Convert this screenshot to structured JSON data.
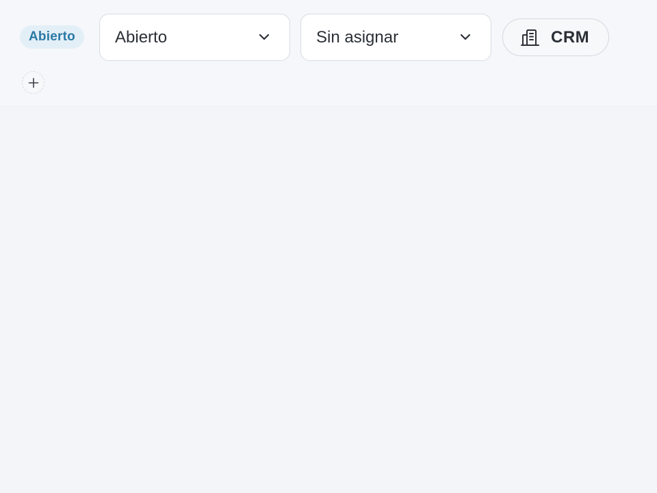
{
  "header": {
    "status_badge": "Abierto",
    "status_select": {
      "value": "Abierto",
      "icon": "chevron-down-icon"
    },
    "assignee_select": {
      "value": "Sin asignar",
      "icon": "chevron-down-icon"
    },
    "crm_button": {
      "label": "CRM",
      "icon": "building-icon"
    },
    "add_button": {
      "icon": "plus-icon"
    }
  },
  "colors": {
    "background": "#f3f5f9",
    "badge_background": "#e3eff7",
    "badge_text": "#2a79a5",
    "text": "#2b2f36",
    "border": "#d7dbe1"
  }
}
